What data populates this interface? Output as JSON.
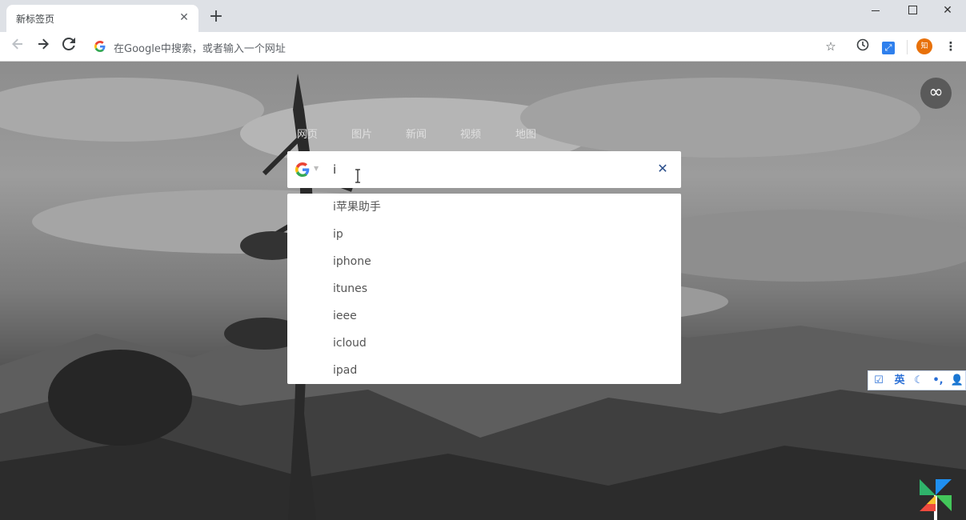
{
  "browser": {
    "tab": {
      "title": "新标签页",
      "close_glyph": "✕"
    },
    "new_tab_glyph": "+",
    "window_controls": [
      "minimize",
      "maximize",
      "close"
    ],
    "nav": {
      "back_icon": "arrow-left-icon",
      "forward_icon": "arrow-right-icon",
      "reload_icon": "reload-icon"
    },
    "omnibox": {
      "placeholder": "在Google中搜索，或者输入一个网址"
    },
    "toolbar_icons": [
      "star-icon",
      "history-icon",
      "extension-icon",
      "avatar",
      "menu-icon"
    ],
    "avatar_text": "知"
  },
  "page": {
    "corner_button": "∞",
    "search_tabs": [
      "网页",
      "图片",
      "新闻",
      "视频",
      "地图"
    ],
    "search": {
      "value": "i",
      "clear_glyph": "✕",
      "engine": "google-icon"
    },
    "suggestions": [
      "i苹果助手",
      "ip",
      "iphone",
      "itunes",
      "ieee",
      "icloud",
      "ipad"
    ],
    "ime_toolbar": {
      "items": [
        "☑",
        "英",
        "☾",
        "•,",
        "👤"
      ]
    }
  },
  "colors": {
    "accent_blue": "#2b4f8c",
    "avatar_orange": "#e8710a",
    "tab_bar": "#dee1e6"
  }
}
